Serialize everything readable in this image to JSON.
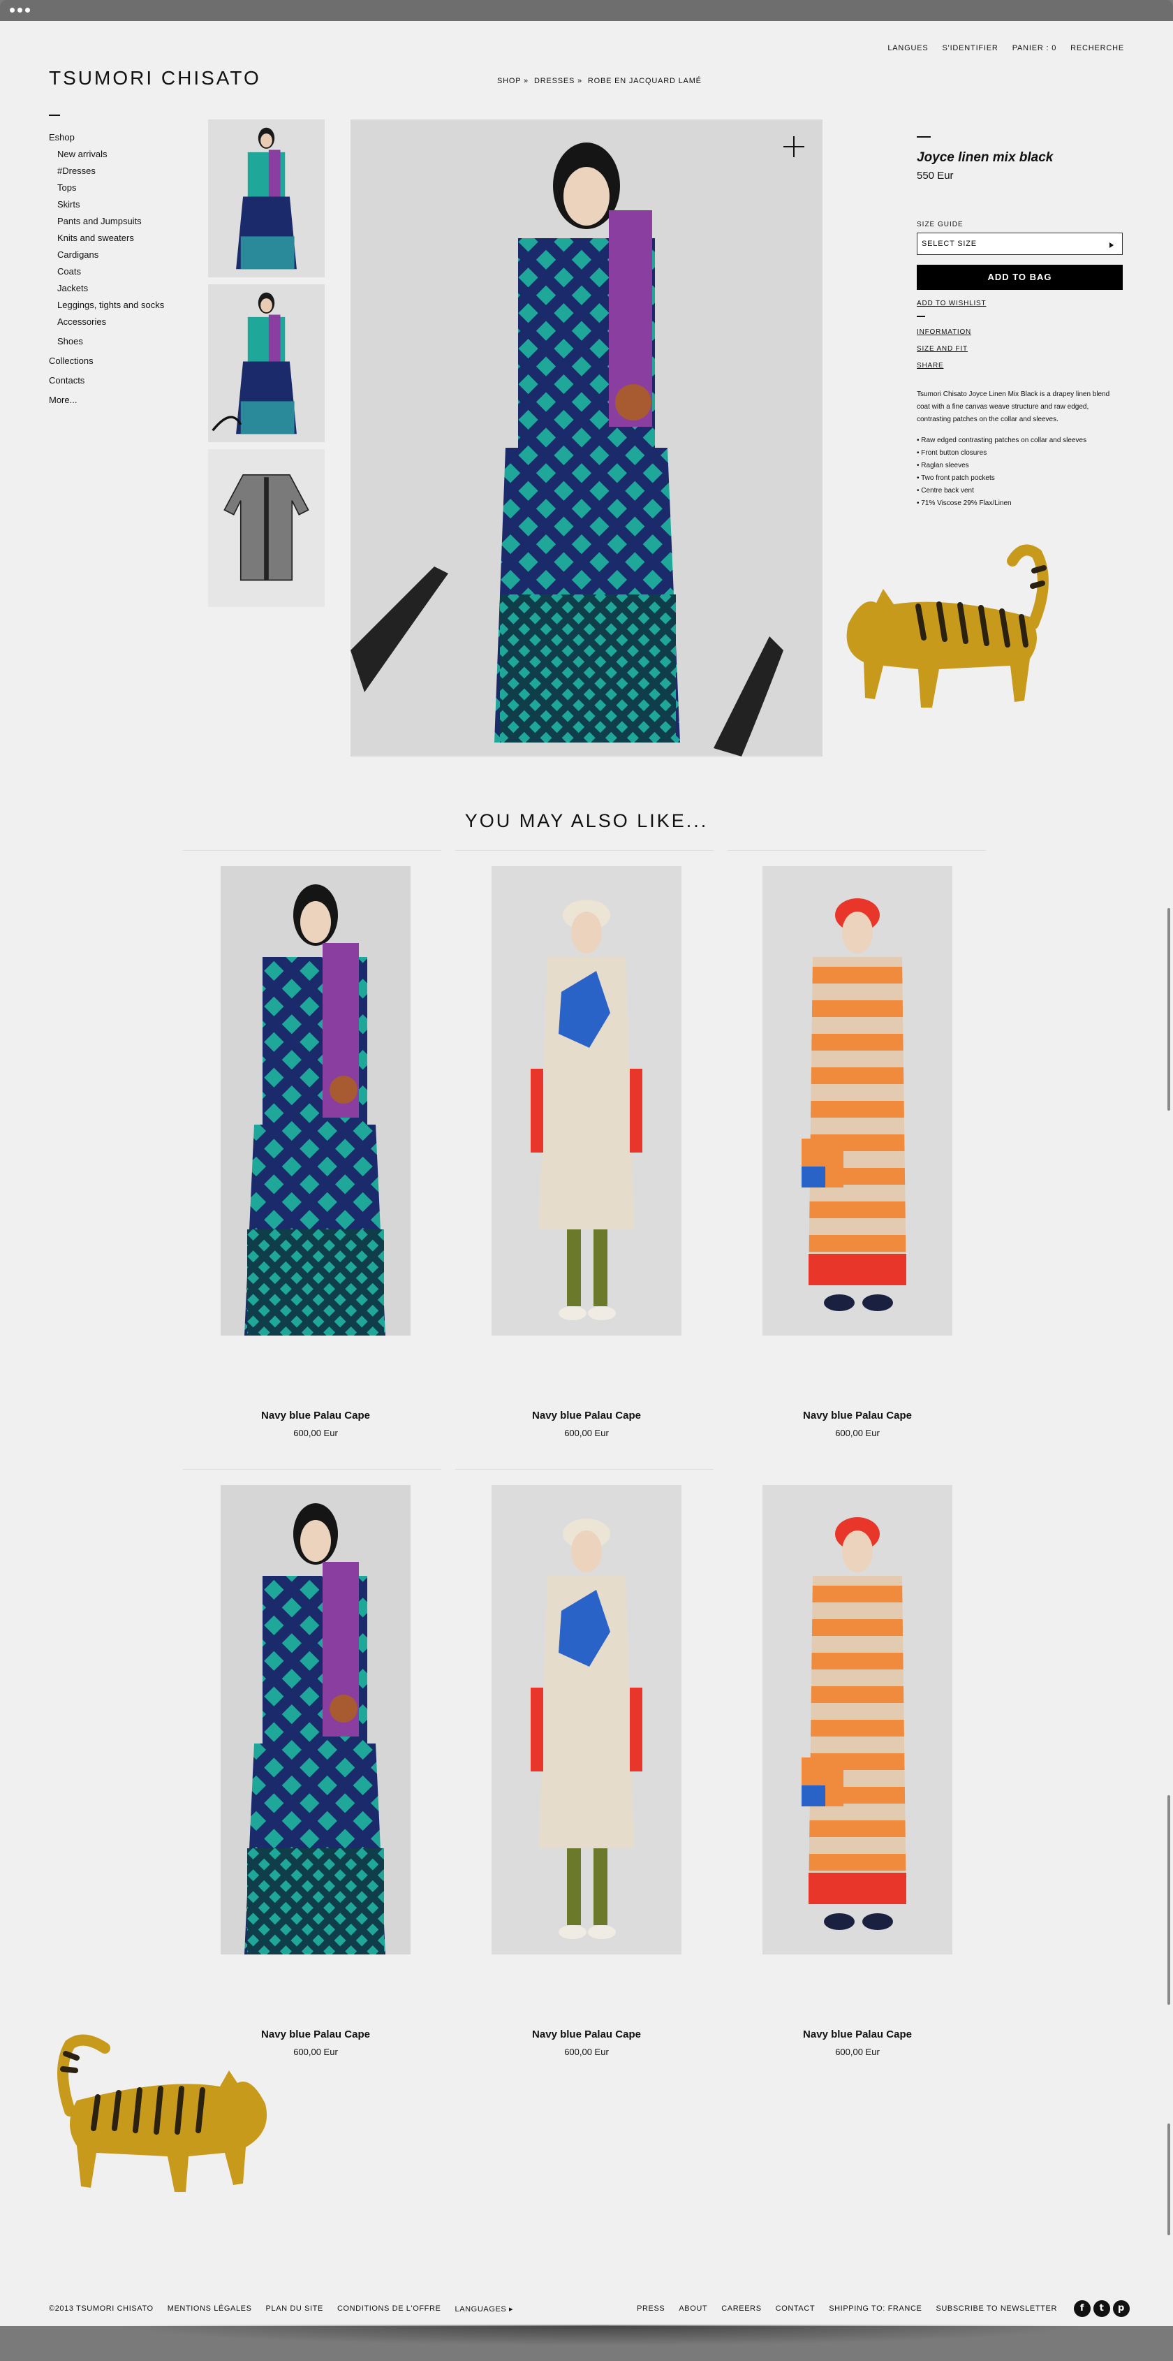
{
  "brand": {
    "logo": "TSUMORI CHISATO"
  },
  "top_nav": [
    "LANGUES",
    "S'IDENTIFIER",
    "PANIER : 0",
    "RECHERCHE"
  ],
  "breadcrumb": {
    "shop": "SHOP »",
    "dresses": "DRESSES »",
    "current": "ROBE EN JACQUARD LAMÉ"
  },
  "sidebar": {
    "eshop": "Eshop",
    "sub": [
      "New arrivals",
      "#Dresses",
      "Tops",
      "Skirts",
      "Pants and Jumpsuits",
      "Knits and sweaters",
      "Cardigans",
      "Coats",
      "Jackets",
      "Leggings, tights and socks",
      "Accessories"
    ],
    "shoes": "Shoes",
    "collections": "Collections",
    "contacts": "Contacts",
    "more": "More..."
  },
  "product": {
    "name": "Joyce linen mix black",
    "price": "550 Eur",
    "size_guide_label": "SIZE GUIDE",
    "select_size": "SELECT SIZE",
    "add_to_bag": "ADD TO BAG",
    "add_to_wishlist": "ADD TO WISHLIST",
    "links": [
      "INFORMATION",
      "SIZE AND FIT",
      "SHARE"
    ],
    "description": "Tsumori Chisato Joyce Linen Mix Black is a drapey linen blend coat with a fine canvas weave structure and raw edged, contrasting patches on the collar and sleeves.",
    "features": [
      "Raw edged contrasting patches on collar and sleeves",
      "Front button closures",
      "Raglan sleeves",
      "Two front patch pockets",
      "Centre back vent",
      "71% Viscose 29% Flax/Linen"
    ]
  },
  "also_like": {
    "title": "YOU MAY ALSO LIKE...",
    "products": [
      {
        "name": "Navy blue Palau Cape",
        "price": "600,00 Eur"
      },
      {
        "name": "Navy blue Palau Cape",
        "price": "600,00 Eur"
      },
      {
        "name": "Navy blue Palau Cape",
        "price": "600,00 Eur"
      },
      {
        "name": "Navy blue Palau Cape",
        "price": "600,00 Eur"
      },
      {
        "name": "Navy blue Palau Cape",
        "price": "600,00 Eur"
      },
      {
        "name": "Navy blue Palau Cape",
        "price": "600,00 Eur"
      }
    ]
  },
  "footer": {
    "left": [
      "©2013 TSUMORI CHISATO",
      "MENTIONS LÉGALES",
      "PLAN DU SITE",
      "CONDITIONS DE L'OFFRE",
      "LANGUAGES ▸"
    ],
    "right": [
      "PRESS",
      "ABOUT",
      "CAREERS",
      "CONTACT",
      "SHIPPING TO: FRANCE",
      "SUBSCRIBE TO NEWSLETTER"
    ],
    "social": [
      "f",
      "t",
      "p"
    ]
  },
  "colors": {
    "teal": "#1fa89a",
    "navy": "#1a2a6b",
    "purple": "#8a3fa0",
    "orange": "#f08a3c",
    "red": "#e8372a",
    "blue": "#2a63c8",
    "tiger": "#c89a1c"
  },
  "icons": {
    "zoom": "plus-icon",
    "select": "caret-right-icon",
    "illustration": "tiger-illustration"
  }
}
